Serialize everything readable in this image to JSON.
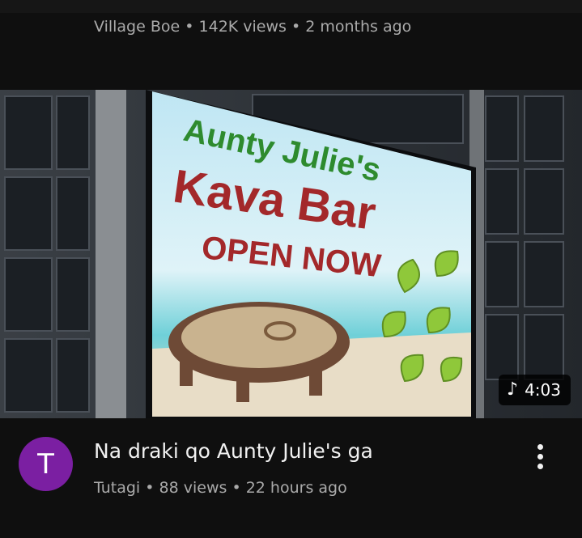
{
  "previous_video": {
    "channel": "Village Boe",
    "views": "142K views",
    "age": "2 months ago"
  },
  "thumbnail": {
    "sign_line1": "Aunty Julie's",
    "sign_line2": "Kava Bar",
    "sign_line3": "OPEN NOW",
    "duration": "4:03",
    "duration_icon": "music-note-icon"
  },
  "video": {
    "avatar_letter": "T",
    "avatar_color": "#7b1fa2",
    "title": "Na draki qo Aunty Julie's ga",
    "channel": "Tutagi",
    "views": "88 views",
    "age": "22 hours ago"
  },
  "menu": {
    "icon": "more-vertical-icon"
  },
  "separator": "•"
}
